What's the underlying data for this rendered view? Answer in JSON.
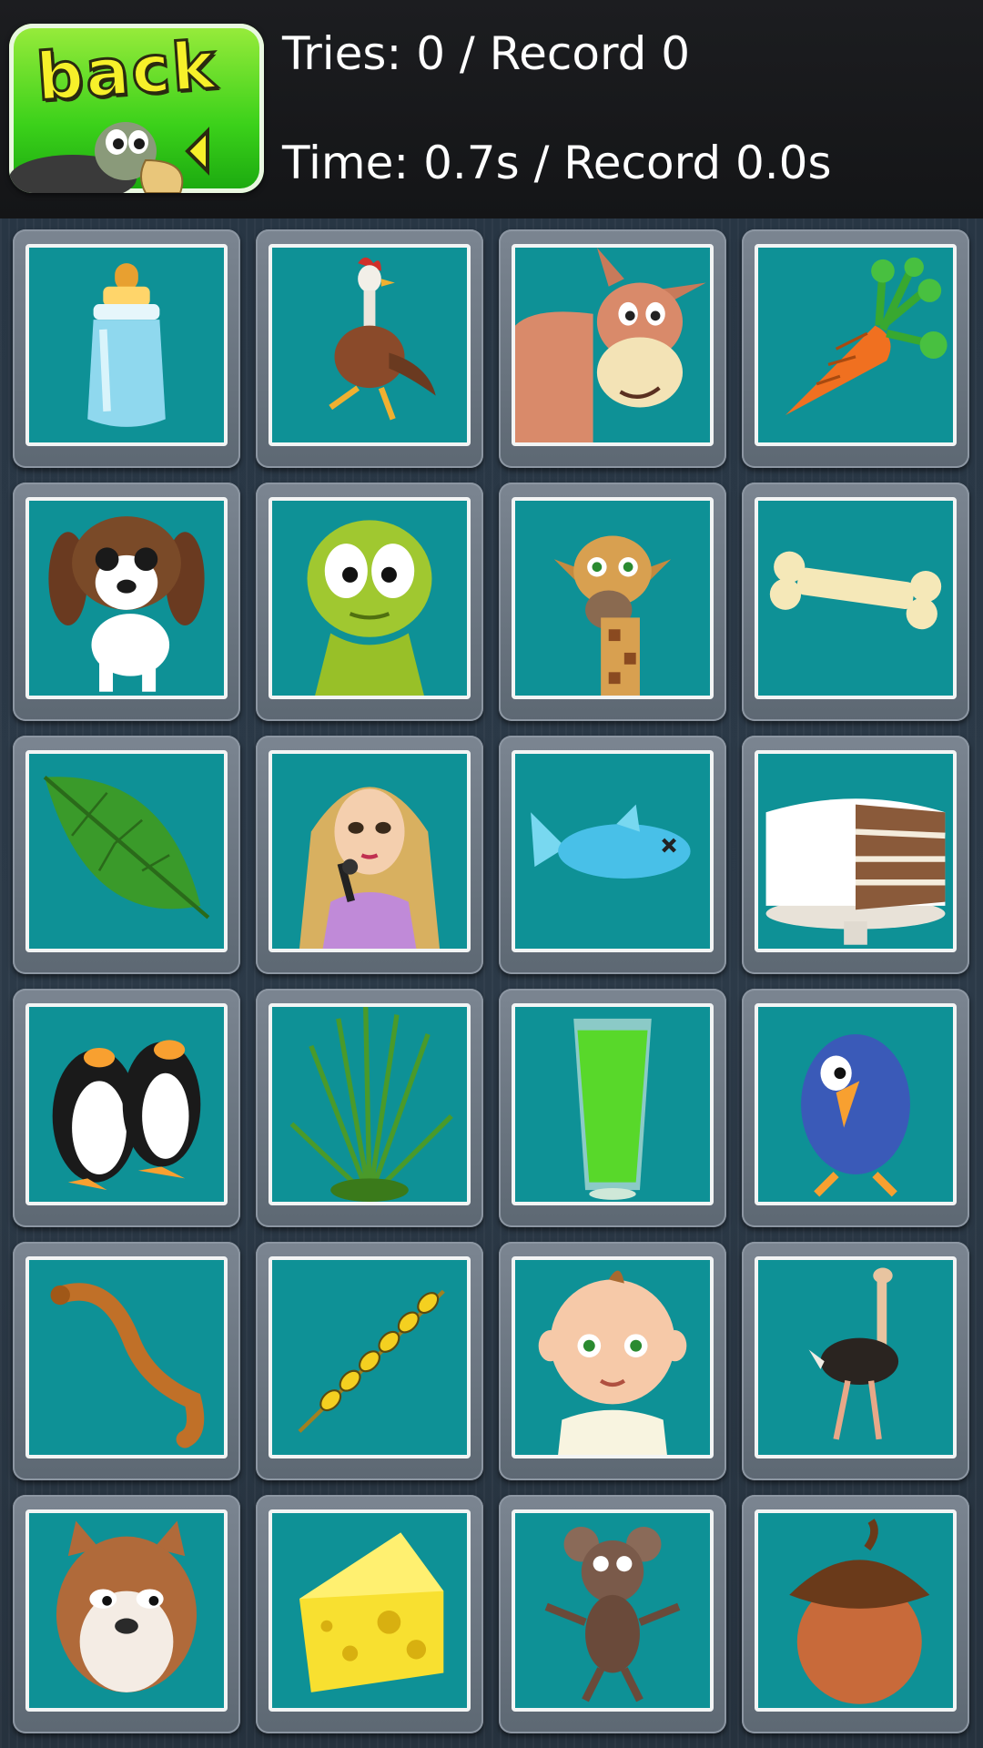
{
  "header": {
    "back_label": "back",
    "tries_text": "Tries: 0 / Record 0",
    "time_text": "Time: 0.7s / Record 0.0s"
  },
  "colors": {
    "tile_face": "#0e9196",
    "tile_frame": "#6b7581",
    "back_green": "#3bd11a",
    "back_text": "#f7f02a"
  },
  "grid": {
    "columns": 4,
    "rows": 6,
    "cards": [
      {
        "name": "baby-bottle"
      },
      {
        "name": "rooster"
      },
      {
        "name": "donkey"
      },
      {
        "name": "carrot"
      },
      {
        "name": "puppy"
      },
      {
        "name": "frog"
      },
      {
        "name": "giraffe"
      },
      {
        "name": "bone"
      },
      {
        "name": "leaf"
      },
      {
        "name": "fairy-singer"
      },
      {
        "name": "fish"
      },
      {
        "name": "cake"
      },
      {
        "name": "penguins"
      },
      {
        "name": "grass"
      },
      {
        "name": "green-drink"
      },
      {
        "name": "blue-bird"
      },
      {
        "name": "worm"
      },
      {
        "name": "wheat"
      },
      {
        "name": "baby"
      },
      {
        "name": "ostrich"
      },
      {
        "name": "squirrel"
      },
      {
        "name": "cheese"
      },
      {
        "name": "mouse"
      },
      {
        "name": "acorn"
      }
    ]
  }
}
